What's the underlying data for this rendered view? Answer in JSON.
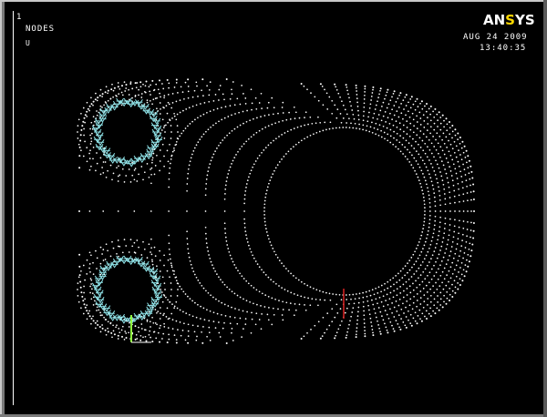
{
  "window": {
    "number": "1",
    "plot_type": "NODES",
    "plot_sub": "U",
    "date": "AUG 24 2009",
    "time": "13:40:35"
  },
  "logo": {
    "prefix": "AN",
    "accent_part": "S",
    "suffix": "YS",
    "text": "ANSYS"
  },
  "colors": {
    "background": "#000000",
    "nodes": "#ffffff",
    "constraints": "#8fe3e8",
    "force_arrow": "#d02020",
    "triad_y": "#90ff40",
    "logo_accent": "#ffd800"
  },
  "symbols": {
    "nodes": "node-dots",
    "constraints": "displacement-constraint-symbols",
    "load": "force-arrow",
    "triad": "coordinate-triad-icon"
  }
}
